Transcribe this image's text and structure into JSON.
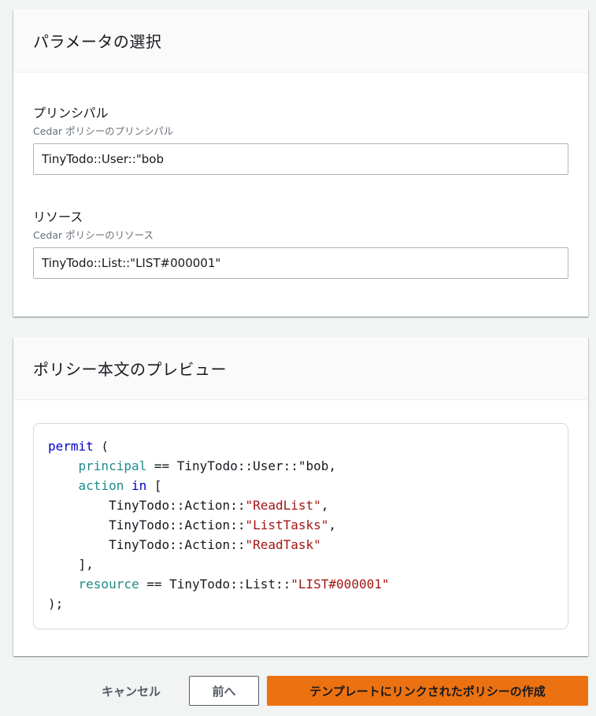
{
  "parameters": {
    "title": "パラメータの選択",
    "principal": {
      "label": "プリンシパル",
      "description": "Cedar ポリシーのプリンシパル",
      "value": "TinyTodo::User::\"bob"
    },
    "resource": {
      "label": "リソース",
      "description": "Cedar ポリシーのリソース",
      "value": "TinyTodo::List::\"LIST#000001\""
    }
  },
  "preview": {
    "title": "ポリシー本文のプレビュー",
    "code": {
      "permit_kw": "permit",
      "open_paren": " (",
      "indent1": "    ",
      "indent2": "        ",
      "principal_kw": "principal",
      "principal_rest": " == TinyTodo::User::\"bob,",
      "action_kw": "action",
      "in_kw": "in",
      "open_bracket": " [",
      "action_prefix": "TinyTodo::Action::",
      "action1": "\"ReadList\"",
      "action2": "\"ListTasks\"",
      "action3": "\"ReadTask\"",
      "comma": ",",
      "close_bracket": "],",
      "resource_kw": "resource",
      "resource_mid": " == TinyTodo::List::",
      "resource_str": "\"LIST#000001\"",
      "close_paren": ");"
    }
  },
  "footer": {
    "cancel_label": "キャンセル",
    "previous_label": "前へ",
    "create_label": "テンプレートにリンクされたポリシーの作成"
  },
  "colors": {
    "primary": "#ec7211",
    "keyword_blue": "#0000cc",
    "keyword_teal": "#208a8a",
    "string_red": "#a31515"
  }
}
